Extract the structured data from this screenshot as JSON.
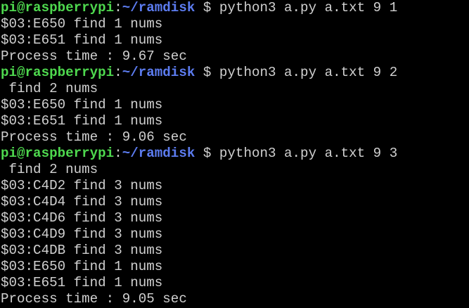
{
  "colors": {
    "background": "#000000",
    "text": "#d0d0d0",
    "user_host": "#4ed84e",
    "path": "#5c7cf0"
  },
  "terminal": {
    "runs": [
      {
        "prompt": {
          "user_host": "pi@raspberrypi",
          "colon": ":",
          "path": "~/ramdisk",
          "dollar": " $ "
        },
        "command": "python3 a.py a.txt 9 1",
        "output": [
          "$03:E650 find 1 nums",
          "$03:E651 find 1 nums",
          "Process time : 9.67 sec"
        ]
      },
      {
        "prompt": {
          "user_host": "pi@raspberrypi",
          "colon": ":",
          "path": "~/ramdisk",
          "dollar": " $ "
        },
        "command": "python3 a.py a.txt 9 2",
        "output": [
          " find 2 nums",
          "$03:E650 find 1 nums",
          "$03:E651 find 1 nums",
          "Process time : 9.06 sec"
        ]
      },
      {
        "prompt": {
          "user_host": "pi@raspberrypi",
          "colon": ":",
          "path": "~/ramdisk",
          "dollar": " $ "
        },
        "command": "python3 a.py a.txt 9 3",
        "output": [
          " find 2 nums",
          "$03:C4D2 find 3 nums",
          "$03:C4D4 find 3 nums",
          "$03:C4D6 find 3 nums",
          "$03:C4D9 find 3 nums",
          "$03:C4DB find 3 nums",
          "$03:E650 find 1 nums",
          "$03:E651 find 1 nums",
          "Process time : 9.05 sec"
        ]
      }
    ]
  }
}
